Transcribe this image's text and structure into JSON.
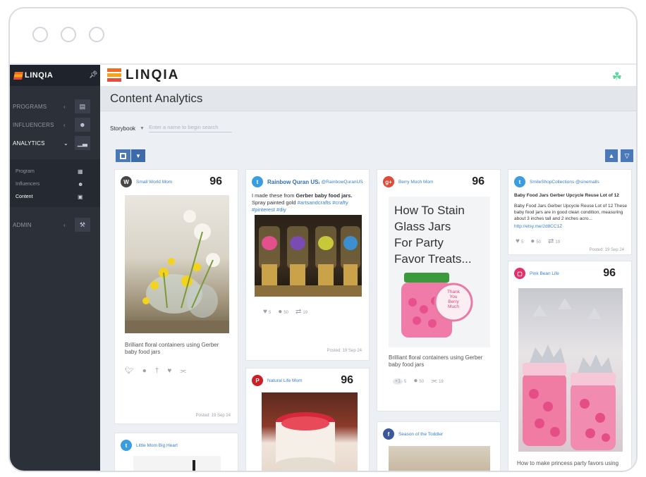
{
  "sidebar": {
    "logo": "LINQIA",
    "nav": [
      {
        "label": "PROGRAMS",
        "icon": "book-icon"
      },
      {
        "label": "INFLUENCERS",
        "icon": "people-icon"
      },
      {
        "label": "ANALYTICS",
        "icon": "chart-icon"
      }
    ],
    "sub": [
      {
        "label": "Program"
      },
      {
        "label": "Influencers"
      },
      {
        "label": "Content"
      }
    ],
    "admin": "ADMIN"
  },
  "header": {
    "brand": "LINQIA",
    "page_title": "Content Analytics"
  },
  "filter": {
    "storybook_label": "Storybook",
    "search_placeholder": "Enter a name to begin search"
  },
  "cards": {
    "c1": {
      "author": "Small World Mom",
      "score": "96",
      "caption": "Brilliant floral containers using Gerber baby food jars",
      "posted": "Posted: 19  Sep 24"
    },
    "c2": {
      "author": "Rainbow Quran USA",
      "handle": "@RainbowQuranUSA",
      "text_a": "I made these from ",
      "text_b": "Gerber baby food jars.",
      "text_c": " Spray painted gold ",
      "tags": "#artsandcrafts #crafty #pinterest #diy",
      "likes": "5",
      "comments": "50",
      "shares": "19",
      "posted": "Posted: 19  Sep 24"
    },
    "c3": {
      "author": "Berry Much Mom",
      "score": "96",
      "img_l1": "How To Stain",
      "img_l2": "Glass Jars",
      "img_l3": "For Party",
      "img_l4": "Favor Treats...",
      "label1": "Thank",
      "label2": "You",
      "label3": "Berry",
      "label4": "Much",
      "caption": "Brilliant floral containers using Gerber baby food jars",
      "plus": "+1",
      "p_cnt": "5",
      "comments": "50",
      "shares": "19"
    },
    "c4": {
      "author": "SmileShopCollections @sinemalls",
      "title": "Baby Food Jars Gerber Upcycle Reuse Lot of 12",
      "body": "Baby Food Jars Gerber Upcycle Reuse Lot of 12 These baby food jars are in good clean condition, measuring about 3 inches tall and 2 inches acro...",
      "link": "http://etsy.me/2d8CC1Z",
      "likes": "5",
      "comments": "50",
      "shares": "19",
      "posted": "Posted: 19  Sep 24"
    },
    "c5": {
      "author": "Natural Life Mom",
      "score": "96"
    },
    "c6": {
      "author": "Pink Bean Life",
      "score": "96",
      "caption": "How to make princess party favors using"
    },
    "c7": {
      "author": "Little Mom Big Heart"
    },
    "c8": {
      "author": "Season of the Toddler"
    }
  },
  "colors": {
    "twitter": "#3a9de0",
    "pinterest": "#cb2027",
    "gplus": "#dd4b39",
    "instagram": "#e1306c",
    "facebook": "#3b5998",
    "wordpress": "#464646",
    "accent": "#4a79b8"
  }
}
